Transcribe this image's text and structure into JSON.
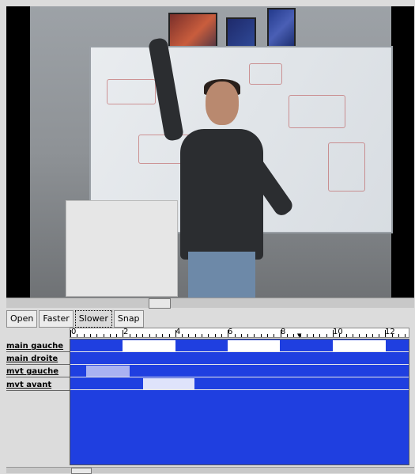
{
  "toolbar": {
    "buttons": [
      {
        "label": "Open",
        "active": false
      },
      {
        "label": "Faster",
        "active": false
      },
      {
        "label": "Slower",
        "active": true
      },
      {
        "label": "Snap",
        "active": false
      }
    ]
  },
  "timeline": {
    "ruler_labels": [
      "0",
      "2",
      "4",
      "6",
      "8",
      "10",
      "12"
    ],
    "track_fill_color": "#1f3fe0",
    "gap_color": "#ffffff",
    "highlight_color": "#a9b2f2",
    "tracks": [
      {
        "label": "main gauche"
      },
      {
        "label": "main droite"
      },
      {
        "label": "mvt gauche"
      },
      {
        "label": "mvt avant"
      }
    ]
  },
  "icons": {
    "playhead": "triangle-down-icon"
  }
}
